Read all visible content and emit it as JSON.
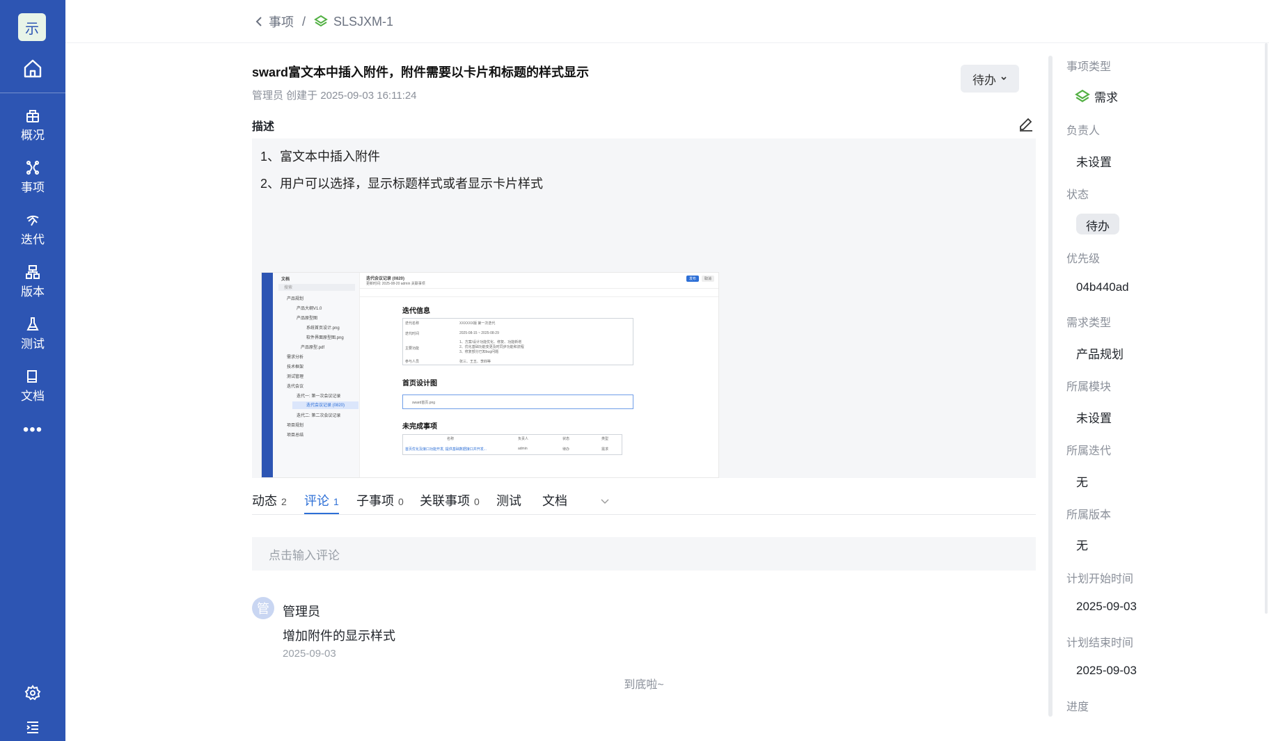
{
  "sidebar": {
    "logo_text": "示",
    "nav": [
      {
        "label": "概况",
        "icon": "overview-icon"
      },
      {
        "label": "事项",
        "icon": "issue-icon"
      },
      {
        "label": "迭代",
        "icon": "sprint-icon"
      },
      {
        "label": "版本",
        "icon": "version-icon"
      },
      {
        "label": "测试",
        "icon": "test-icon"
      },
      {
        "label": "文档",
        "icon": "document-icon"
      }
    ],
    "more": "•••"
  },
  "breadcrumb": {
    "parent": "事项",
    "separator": "/",
    "current": "SLSJXM-1"
  },
  "issue": {
    "title": "sward富文本中插入附件，附件需要以卡片和标题的样式显示",
    "meta": "管理员 创建于 2025-09-03 16:11:24",
    "status_button": "待办",
    "description_label": "描述",
    "description_lines": [
      "1、富文本中插入附件",
      "2、用户可以选择，显示标题样式或者显示卡片样式"
    ]
  },
  "embedded_screenshot": {
    "sidebar_title": "文档",
    "search": "搜索",
    "tree": [
      "产品规划",
      "产品大纲V1.0",
      "产品原型图",
      "系统首页设计.png",
      "软件界面原型图.png",
      "产品原型.pdf",
      "需求分析",
      "技术框架",
      "测试管理",
      "迭代会议",
      "迭代一: 第一次会议记录",
      "迭代会议记录 (0820)",
      "迭代二: 第二次会议记录",
      "项目规划",
      "项目总结"
    ],
    "doc_title": "迭代会议记录 (0820)",
    "doc_meta": "更新时间: 2025-08-20 admin    关联事项",
    "section1": "迭代信息",
    "table1": [
      [
        "迭代名称",
        "XXXXXX版 第一次迭代"
      ],
      [
        "迭代时间",
        "2025-08-15  ~  2025-08-29"
      ],
      [
        "主要功能",
        "1、方案/设计功能优化、修复、功能新增\n2、优化基础功能变更及时同步功能和流程\n3、修复部分已知bug问题"
      ],
      [
        "参与人员",
        "张三、王五、李四等"
      ]
    ],
    "section2": "首页设计图",
    "attachment": "sward首页.png",
    "section3": "未完成事项",
    "table2_headers": [
      "名称",
      "负责人",
      "状态",
      "类型"
    ],
    "table2_row": [
      "首页优化及接口功能开发, 提供基础数据接口并开发...",
      "admin",
      "待办",
      "需求"
    ],
    "btn_publish": "发布",
    "btn_cancel": "取消"
  },
  "tabs": [
    {
      "label": "动态",
      "count": "2"
    },
    {
      "label": "评论",
      "count": "1"
    },
    {
      "label": "子事项",
      "count": "0"
    },
    {
      "label": "关联事项",
      "count": "0"
    },
    {
      "label": "测试",
      "count": ""
    },
    {
      "label": "文档",
      "count": ""
    }
  ],
  "comments": {
    "placeholder": "点击输入评论",
    "items": [
      {
        "avatar": "管",
        "author": "管理员",
        "text": "增加附件的显示样式",
        "date": "2025-09-03"
      }
    ],
    "end_text": "到底啦~"
  },
  "details": [
    {
      "label": "事项类型",
      "value": "需求"
    },
    {
      "label": "负责人",
      "value": "未设置"
    },
    {
      "label": "状态",
      "value": "待办"
    },
    {
      "label": "优先级",
      "value": "04b440ad"
    },
    {
      "label": "需求类型",
      "value": "产品规划"
    },
    {
      "label": "所属模块",
      "value": "未设置"
    },
    {
      "label": "所属迭代",
      "value": "无"
    },
    {
      "label": "所属版本",
      "value": "无"
    },
    {
      "label": "计划开始时间",
      "value": "2025-09-03"
    },
    {
      "label": "计划结束时间",
      "value": "2025-09-03"
    },
    {
      "label": "进度",
      "value": ""
    }
  ],
  "colors": {
    "sidebar": "#2d55b3",
    "accent": "#2d6fd6",
    "issue_type_icon": "#52b043"
  }
}
